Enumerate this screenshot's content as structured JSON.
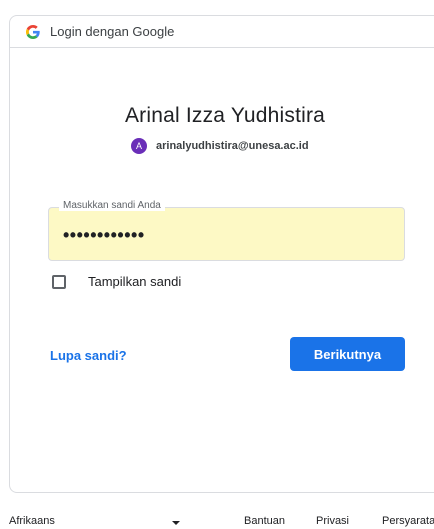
{
  "header": {
    "title": "Login dengan Google",
    "logo_icon": "google-g-icon"
  },
  "account": {
    "name": "Arinal Izza Yudhistira",
    "avatar_letter": "A",
    "email": "arinalyudhistira@unesa.ac.id",
    "avatar_color": "#6a2eb8"
  },
  "password": {
    "label": "Masukkan sandi Anda",
    "value": "••••••••••••",
    "autofill_bg": "#fdf9c5"
  },
  "show_password": {
    "label": "Tampilkan sandi",
    "checked": false
  },
  "actions": {
    "forgot_label": "Lupa sandi?",
    "next_label": "Berikutnya",
    "accent": "#1a73e8"
  },
  "footer": {
    "language": "Afrikaans",
    "help": "Bantuan",
    "privacy": "Privasi",
    "terms": "Persyaratan"
  }
}
